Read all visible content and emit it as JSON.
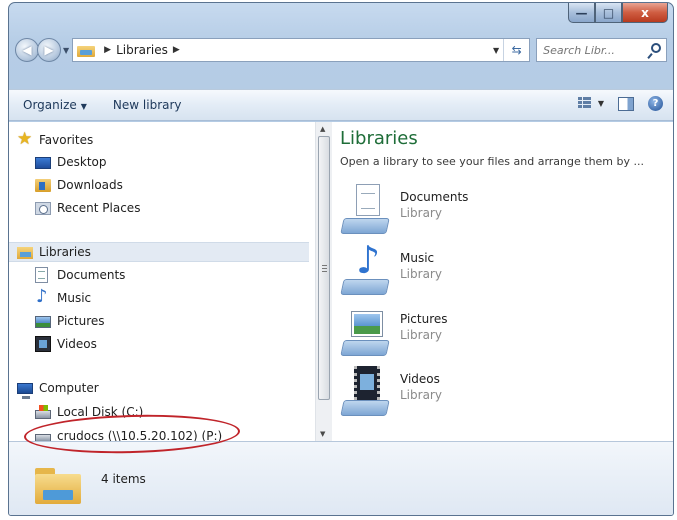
{
  "window": {
    "controls": {
      "minimize": "—",
      "maximize": "□",
      "close": "x"
    }
  },
  "address_bar": {
    "crumb": "Libraries",
    "search_placeholder": "Search Libr..."
  },
  "command_bar": {
    "organize": "Organize",
    "new_library": "New library"
  },
  "navigation": {
    "favorites": {
      "label": "Favorites",
      "items": [
        "Desktop",
        "Downloads",
        "Recent Places"
      ]
    },
    "libraries": {
      "label": "Libraries",
      "items": [
        "Documents",
        "Music",
        "Pictures",
        "Videos"
      ]
    },
    "computer": {
      "label": "Computer",
      "items": [
        "Local Disk (C:)",
        "crudocs (\\\\10.5.20.102) (P:)"
      ]
    },
    "selected": "Libraries"
  },
  "content": {
    "title": "Libraries",
    "subtitle": "Open a library to see your files and arrange them by ...",
    "libraries": [
      {
        "name": "Documents",
        "type": "Library",
        "icon": "documents-library-icon"
      },
      {
        "name": "Music",
        "type": "Library",
        "icon": "music-library-icon"
      },
      {
        "name": "Pictures",
        "type": "Library",
        "icon": "pictures-library-icon"
      },
      {
        "name": "Videos",
        "type": "Library",
        "icon": "videos-library-icon"
      }
    ]
  },
  "details": {
    "count": "4 items"
  },
  "colors": {
    "title_green": "#1e6d38",
    "annotation_red": "#c0242a",
    "frame_blue": "#b6cde6"
  }
}
